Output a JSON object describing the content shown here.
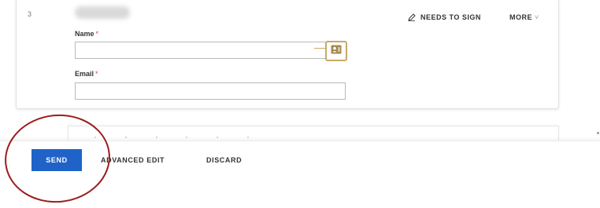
{
  "recipient": {
    "index": "3",
    "action_label": "NEEDS TO SIGN",
    "more_label": "MORE",
    "more_caret": "˅",
    "name_label": "Name",
    "email_label": "Email",
    "required_marker": "*",
    "name_value": "",
    "email_value": "",
    "contacts_icon": "contact-card-icon",
    "action_icon": "pen-icon"
  },
  "footer": {
    "send_label": "SEND",
    "advanced_edit_label": "ADVANCED EDIT",
    "discard_label": "DISCARD"
  },
  "colors": {
    "accent": "#1f63c9",
    "highlight_outline": "#9c1c1c",
    "contacts_border": "#c8a96a",
    "required": "#d04848"
  }
}
